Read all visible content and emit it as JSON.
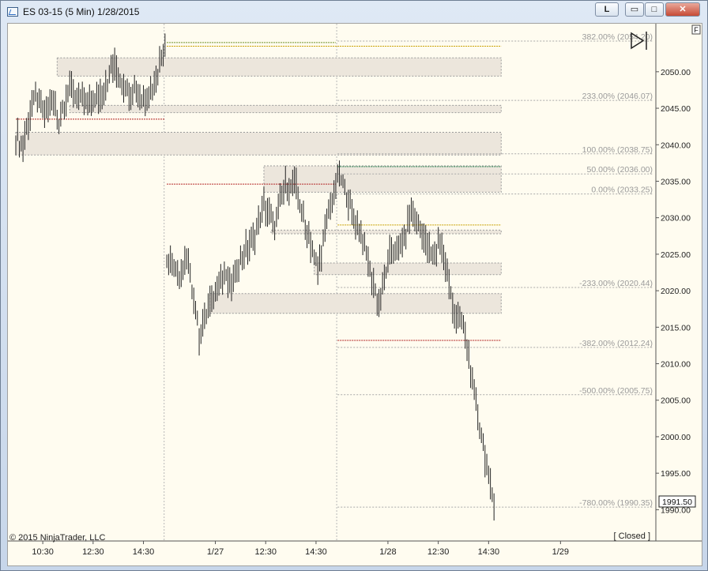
{
  "window": {
    "title": "ES 03-15 (5 Min)  1/28/2015",
    "buttons": {
      "link": "L",
      "minimize": "▭",
      "maximize": "□",
      "close": "✕"
    },
    "f_label": "F",
    "copyright": "© 2015 NinjaTrader, LLC",
    "status": "[ Closed ]",
    "last_price": "1991.50"
  },
  "chart_data": {
    "type": "ohlc",
    "instrument": "ES 03-15",
    "interval": "5 Min",
    "ylim": [
      1989.5,
      2055.5
    ],
    "y_ticks": [
      1990,
      1995,
      2000,
      2005,
      2010,
      2015,
      2020,
      2025,
      2030,
      2035,
      2040,
      2045,
      2050
    ],
    "y_tick_labels": [
      "1990.00",
      "1995.00",
      "2000.00",
      "2005.00",
      "2010.00",
      "2015.00",
      "2020.00",
      "2025.00",
      "2030.00",
      "2035.00",
      "2040.00",
      "2045.00",
      "2050.00"
    ],
    "x_tick_labels": [
      "10:30",
      "12:30",
      "14:30",
      "1/27",
      "12:30",
      "14:30",
      "1/28",
      "12:30",
      "14:30",
      "1/29"
    ],
    "x_tick_bars": [
      15,
      43,
      71,
      111,
      139,
      167,
      207,
      235,
      263,
      303
    ],
    "session_breaks": [
      83,
      179
    ],
    "total_bars": 310,
    "fib_levels": [
      {
        "label": "-780.00% (1990.35)",
        "value": 1990.35
      },
      {
        "label": "-500.00% (2005.75)",
        "value": 2005.75
      },
      {
        "label": "-382.00% (2012.24)",
        "value": 2012.24
      },
      {
        "label": "-233.00% (2020.44)",
        "value": 2020.44
      },
      {
        "label": "0.00% (2033.25)",
        "value": 2033.25
      },
      {
        "label": "50.00% (2036.00)",
        "value": 2036.0
      },
      {
        "label": "100.00% (2038.75)",
        "value": 2038.75
      },
      {
        "label": "233.00% (2046.07)",
        "value": 2046.07
      },
      {
        "label": "382.00% (2054.20)",
        "value": 2054.2
      }
    ],
    "zones": [
      {
        "x0": 23,
        "x1": 270,
        "lo": 2049.4,
        "hi": 2051.9
      },
      {
        "x0": 30,
        "x1": 270,
        "lo": 2044.4,
        "hi": 2045.4
      },
      {
        "x0": 0,
        "x1": 270,
        "lo": 2038.6,
        "hi": 2041.7
      },
      {
        "x0": 138,
        "x1": 270,
        "lo": 2033.5,
        "hi": 2037.1
      },
      {
        "x0": 142,
        "x1": 270,
        "lo": 2027.8,
        "hi": 2028.3
      },
      {
        "x0": 166,
        "x1": 270,
        "lo": 2022.2,
        "hi": 2023.8
      },
      {
        "x0": 108,
        "x1": 270,
        "lo": 2016.9,
        "hi": 2019.6
      }
    ],
    "lines": [
      {
        "x0": 84,
        "x1": 178,
        "value": 2054.0,
        "color": "#6b8e23"
      },
      {
        "x0": 84,
        "x1": 270,
        "value": 2053.5,
        "color": "#c8a000"
      },
      {
        "x0": 0,
        "x1": 83,
        "value": 2043.5,
        "color": "#b22222"
      },
      {
        "x0": 84,
        "x1": 178,
        "value": 2034.6,
        "color": "#b22222"
      },
      {
        "x0": 179,
        "x1": 270,
        "value": 2037.0,
        "color": "#2e8b57"
      },
      {
        "x0": 179,
        "x1": 270,
        "value": 2029.0,
        "color": "#c8a000"
      },
      {
        "x0": 179,
        "x1": 270,
        "value": 2013.2,
        "color": "#b22222"
      }
    ],
    "path_points": [
      [
        0,
        2041.0
      ],
      [
        4,
        2040.0
      ],
      [
        8,
        2044.5
      ],
      [
        12,
        2047.0
      ],
      [
        16,
        2044.0
      ],
      [
        20,
        2046.0
      ],
      [
        24,
        2043.5
      ],
      [
        30,
        2048.0
      ],
      [
        36,
        2046.0
      ],
      [
        42,
        2045.5
      ],
      [
        48,
        2047.0
      ],
      [
        54,
        2051.0
      ],
      [
        60,
        2048.0
      ],
      [
        66,
        2047.5
      ],
      [
        72,
        2046.0
      ],
      [
        78,
        2049.0
      ],
      [
        83,
        2053.5
      ],
      [
        84,
        2025.0
      ],
      [
        90,
        2022.0
      ],
      [
        96,
        2024.0
      ],
      [
        102,
        2014.0
      ],
      [
        108,
        2018.0
      ],
      [
        114,
        2022.0
      ],
      [
        120,
        2021.0
      ],
      [
        126,
        2025.0
      ],
      [
        132,
        2027.0
      ],
      [
        138,
        2032.0
      ],
      [
        144,
        2029.0
      ],
      [
        150,
        2034.5
      ],
      [
        156,
        2034.0
      ],
      [
        162,
        2028.0
      ],
      [
        168,
        2023.0
      ],
      [
        174,
        2031.0
      ],
      [
        178,
        2034.0
      ],
      [
        179,
        2036.5
      ],
      [
        184,
        2033.0
      ],
      [
        190,
        2029.0
      ],
      [
        196,
        2024.0
      ],
      [
        202,
        2018.0
      ],
      [
        208,
        2025.0
      ],
      [
        214,
        2026.0
      ],
      [
        220,
        2030.5
      ],
      [
        226,
        2028.0
      ],
      [
        232,
        2024.0
      ],
      [
        236,
        2027.0
      ],
      [
        240,
        2022.0
      ],
      [
        244,
        2017.0
      ],
      [
        248,
        2016.0
      ],
      [
        252,
        2011.0
      ],
      [
        256,
        2004.0
      ],
      [
        260,
        1999.0
      ],
      [
        264,
        1993.0
      ],
      [
        266,
        1991.5
      ]
    ]
  }
}
